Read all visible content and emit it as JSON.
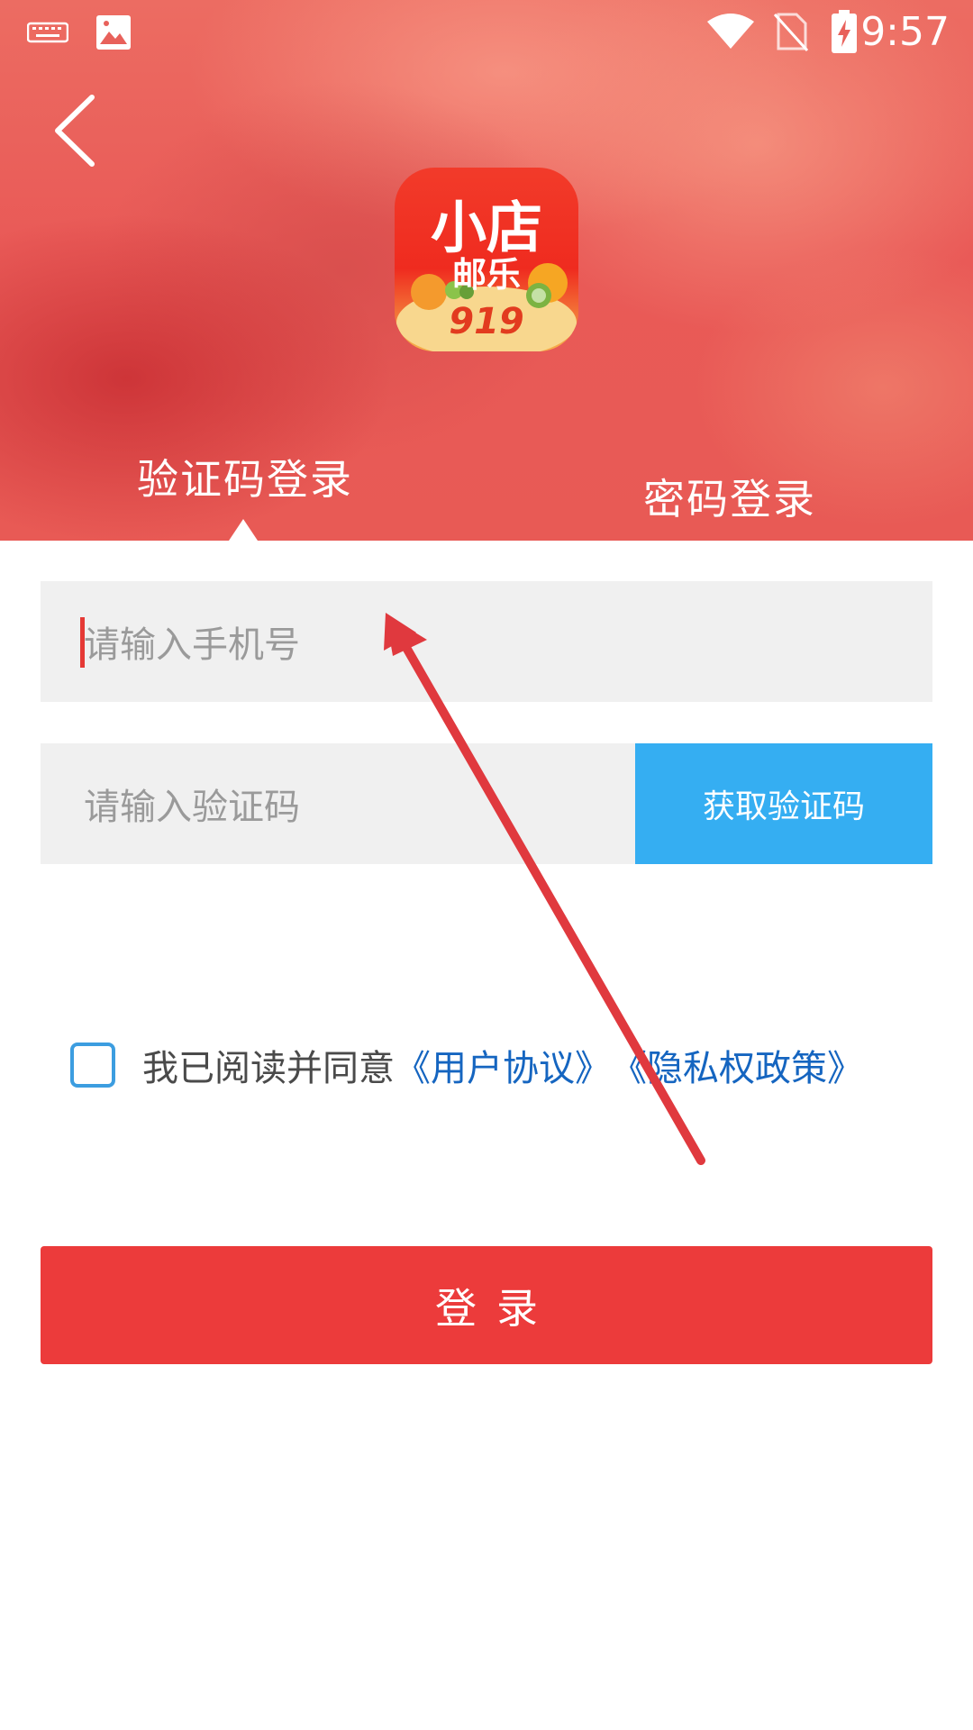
{
  "status_bar": {
    "time": "9:57",
    "icons": [
      "keyboard-icon",
      "image-icon",
      "wifi-icon",
      "no-sim-icon",
      "battery-charging-icon"
    ]
  },
  "header": {
    "back_icon": "chevron-left-icon",
    "logo": {
      "line1": "小店",
      "line2": "邮乐",
      "number": "919"
    },
    "tabs": [
      {
        "label": "验证码登录",
        "active": true
      },
      {
        "label": "密码登录",
        "active": false
      }
    ]
  },
  "form": {
    "phone_placeholder": "请输入手机号",
    "code_placeholder": "请输入验证码",
    "get_code_label": "获取验证码",
    "agreement": {
      "checked": false,
      "text": "我已阅读并同意",
      "user_agreement": "《用户协议》",
      "privacy_policy": "《隐私权政策》"
    },
    "login_label": "登录"
  },
  "colors": {
    "accent_red": "#ec3b3b",
    "button_blue": "#35aef2",
    "link_blue": "#1565c0",
    "annotation_arrow": "#e0393e"
  }
}
